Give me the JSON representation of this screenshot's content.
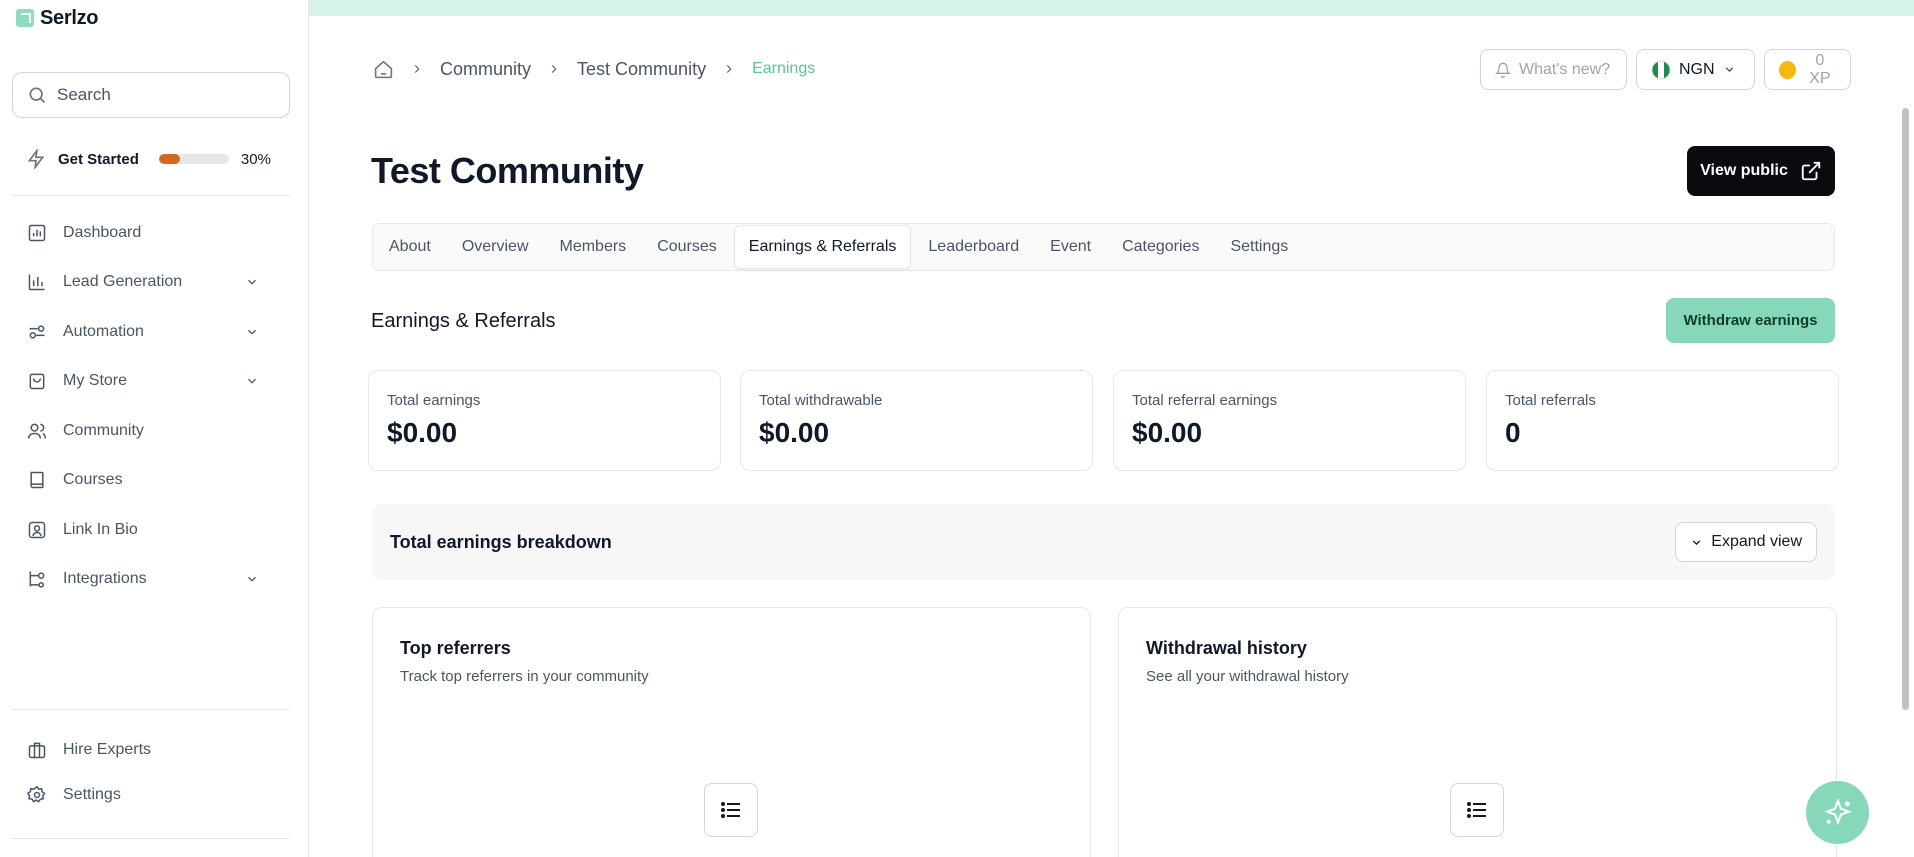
{
  "app": {
    "name": "Serlzo"
  },
  "search": {
    "placeholder": "Search"
  },
  "get_started": {
    "label": "Get Started",
    "progress_percent": 30,
    "progress_text": "30%",
    "progress_color": "#d2691e"
  },
  "sidebar": {
    "items": [
      {
        "label": "Dashboard",
        "icon": "chart-icon",
        "has_chevron": false
      },
      {
        "label": "Lead Generation",
        "icon": "bar-chart-icon",
        "has_chevron": true
      },
      {
        "label": "Automation",
        "icon": "sliders-icon",
        "has_chevron": true
      },
      {
        "label": "My Store",
        "icon": "shopping-bag-icon",
        "has_chevron": true
      },
      {
        "label": "Community",
        "icon": "users-icon",
        "has_chevron": false
      },
      {
        "label": "Courses",
        "icon": "book-icon",
        "has_chevron": false
      },
      {
        "label": "Link In Bio",
        "icon": "user-square-icon",
        "has_chevron": false
      },
      {
        "label": "Integrations",
        "icon": "workflow-icon",
        "has_chevron": true
      }
    ],
    "bottom_items": [
      {
        "label": "Hire Experts",
        "icon": "briefcase-icon"
      },
      {
        "label": "Settings",
        "icon": "gear-icon"
      }
    ]
  },
  "breadcrumb": {
    "items": [
      "Community",
      "Test Community"
    ],
    "current": "Earnings"
  },
  "header": {
    "whats_new": "What's new?",
    "currency": "NGN",
    "xp": "0 XP"
  },
  "page": {
    "title": "Test Community",
    "view_public": "View public"
  },
  "tabs": [
    {
      "label": "About"
    },
    {
      "label": "Overview"
    },
    {
      "label": "Members"
    },
    {
      "label": "Courses"
    },
    {
      "label": "Earnings & Referrals",
      "active": true
    },
    {
      "label": "Leaderboard"
    },
    {
      "label": "Event"
    },
    {
      "label": "Categories"
    },
    {
      "label": "Settings"
    }
  ],
  "section": {
    "title": "Earnings & Referrals",
    "withdraw_label": "Withdraw earnings"
  },
  "stats": [
    {
      "label": "Total earnings",
      "value": "$0.00"
    },
    {
      "label": "Total withdrawable",
      "value": "$0.00"
    },
    {
      "label": "Total referral earnings",
      "value": "$0.00"
    },
    {
      "label": "Total referrals",
      "value": "0"
    }
  ],
  "breakdown": {
    "title": "Total earnings breakdown",
    "expand_label": "Expand view"
  },
  "panels": [
    {
      "title": "Top referrers",
      "subtitle": "Track top referrers in your community"
    },
    {
      "title": "Withdrawal history",
      "subtitle": "See all your withdrawal history"
    }
  ],
  "colors": {
    "accent": "#86d8b9",
    "breadcrumb_current": "#5cc49a",
    "dark_button": "#0b0b0f"
  }
}
